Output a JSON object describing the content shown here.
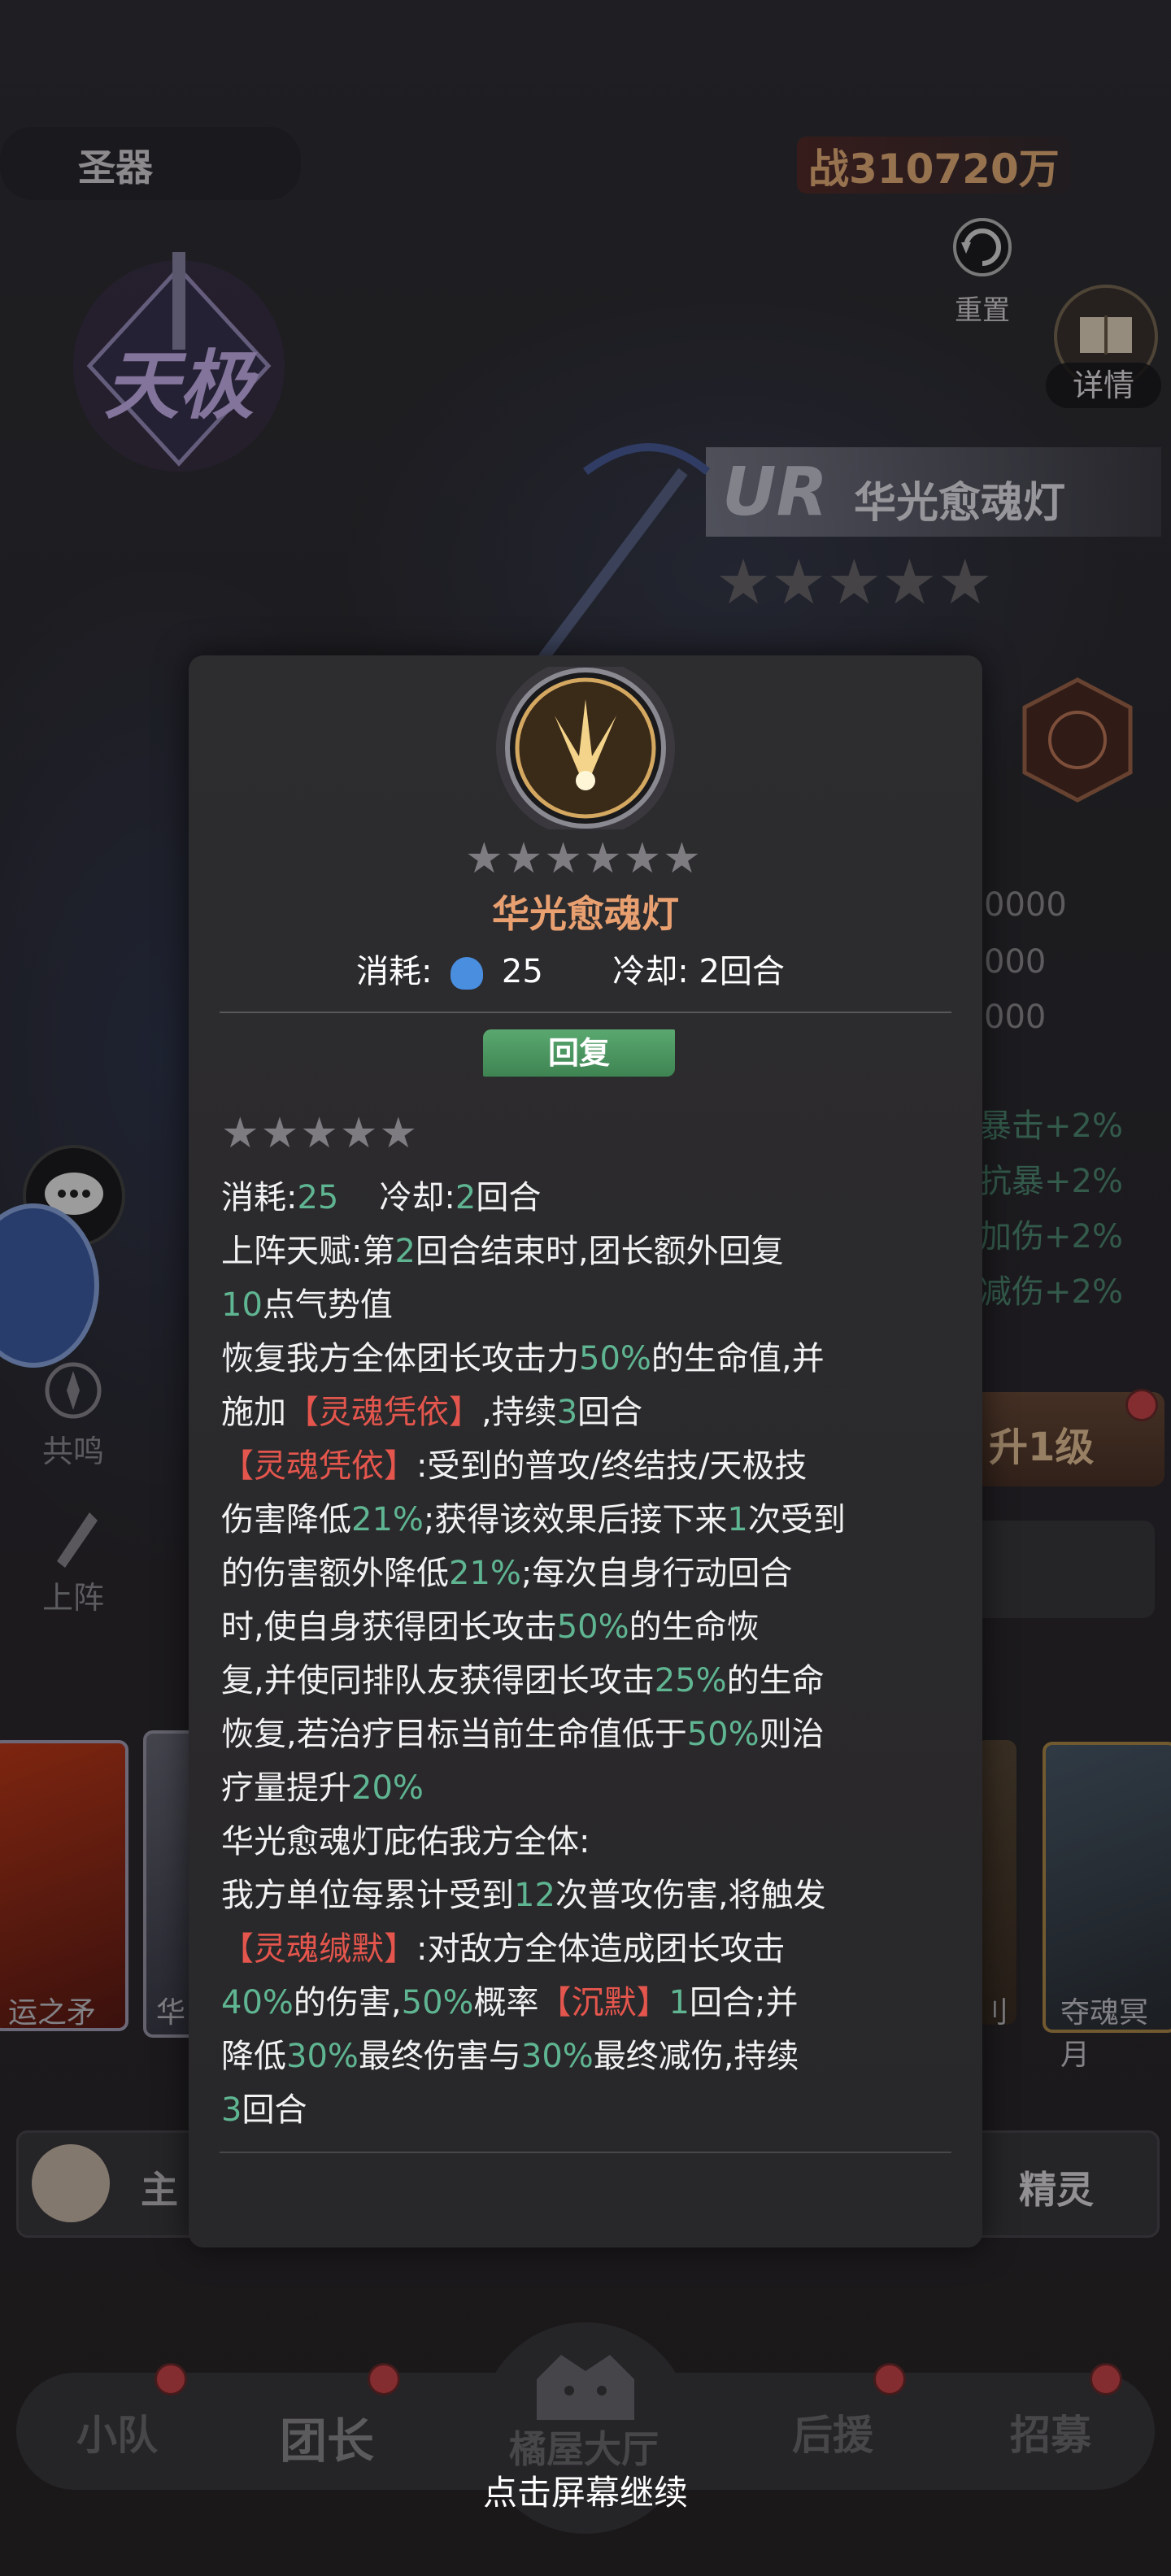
{
  "header": {
    "section_label": "圣器",
    "power_prefix": "战",
    "power_value": "310720万",
    "reset_label": "重置",
    "detail_label": "详情",
    "rank_badge": "天极"
  },
  "artifact_panel": {
    "rarity": "UR",
    "name": "华光愈魂灯",
    "stars": 5
  },
  "stats_partial": [
    "0000",
    "000",
    "000"
  ],
  "bonus_partial": [
    "暴击+2%",
    "抗暴+2%",
    "加伤+2%",
    "减伤+2%"
  ],
  "upgrade_partial": "升1级",
  "side_buttons": {
    "resonate": "共鸣",
    "deploy": "上阵"
  },
  "cards": [
    {
      "label": "运之矛"
    },
    {
      "label": "华"
    },
    {
      "label": "刂"
    },
    {
      "label": "夺魂冥月"
    }
  ],
  "bottom_bar": {
    "left_partial": "主",
    "right_label": "精灵"
  },
  "popup": {
    "name": "华光愈魂灯",
    "cost_label": "消耗:",
    "cost_value": "25",
    "cooldown_label": "冷却:",
    "cooldown_value": "2回合",
    "tag": "回复",
    "star_count": 5,
    "desc": {
      "l1_a": "消耗:",
      "l1_b": "25",
      "l1_c": "冷却:",
      "l1_d": "2",
      "l1_e": "回合",
      "l2_a": "上阵天赋:第",
      "l2_b": "2",
      "l2_c": "回合结束时,团长额外回复",
      "l3_a": "10",
      "l3_b": "点气势值",
      "l4_a": "恢复我方全体团长攻击力",
      "l4_b": "50%",
      "l4_c": "的生命值,并",
      "l5_a": "施加",
      "l5_b": "【灵魂凭依】",
      "l5_c": ",持续",
      "l5_d": "3",
      "l5_e": "回合",
      "l6_a": "【灵魂凭依】",
      "l6_b": ":受到的普攻/终结技/天极技",
      "l7_a": "伤害降低",
      "l7_b": "21%",
      "l7_c": ";获得该效果后接下来",
      "l7_d": "1",
      "l7_e": "次受到",
      "l8_a": "的伤害额外降低",
      "l8_b": "21%",
      "l8_c": ";每次自身行动回合",
      "l9_a": "时,使自身获得团长攻击",
      "l9_b": "50%",
      "l9_c": "的生命恢",
      "l10_a": "复,并使同排队友获得团长攻击",
      "l10_b": "25%",
      "l10_c": "的生命",
      "l11_a": "恢复,若治疗目标当前生命值低于",
      "l11_b": "50%",
      "l11_c": "则治",
      "l12_a": "疗量提升",
      "l12_b": "20%",
      "l13": "华光愈魂灯庇佑我方全体:",
      "l14_a": "我方单位每累计受到",
      "l14_b": "12",
      "l14_c": "次普攻伤害,将触发",
      "l15_a": "【灵魂缄默】",
      "l15_b": ":对敌方全体造成团长攻击",
      "l16_a": "40%",
      "l16_b": "的伤害,",
      "l16_c": "50%",
      "l16_d": "概率",
      "l16_e": "【沉默】",
      "l16_f": "1",
      "l16_g": "回合;并",
      "l17_a": "降低",
      "l17_b": "30%",
      "l17_c": "最终伤害与",
      "l17_d": "30%",
      "l17_e": "最终减伤,持续",
      "l18_a": "3",
      "l18_b": "回合"
    }
  },
  "nav": {
    "items": [
      "小队",
      "团长",
      "橘屋大厅",
      "后援",
      "招募"
    ],
    "active": "团长"
  },
  "continue_hint": "点击屏幕继续",
  "colors": {
    "highlight_green": "#5fb592",
    "highlight_red": "#e4564d",
    "tag_green": "#4c9a62",
    "popup_bg": "#2d2c2f"
  }
}
